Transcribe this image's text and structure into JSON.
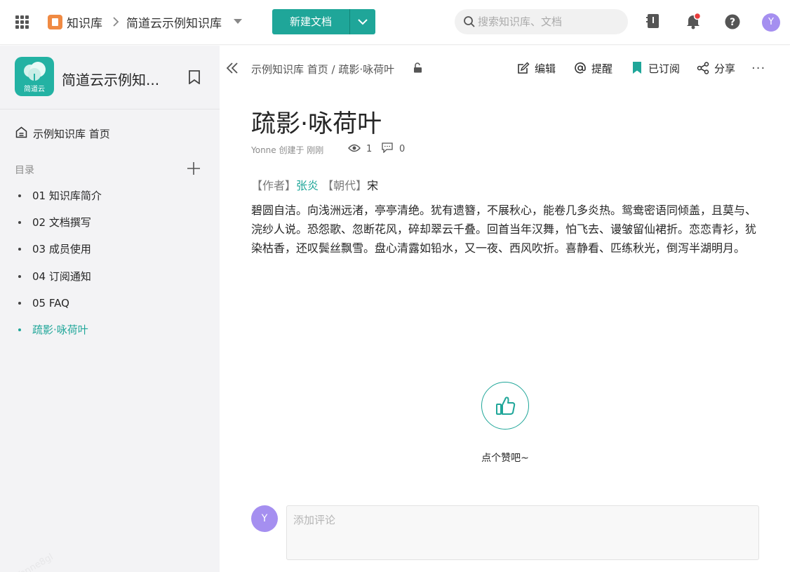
{
  "topbar": {
    "kb_label": "知识库",
    "space_name": "简道云示例知识库",
    "new_doc_label": "新建文档",
    "search_placeholder": "搜索知识库、文档",
    "avatar_initial": "Y",
    "notification_dot_color": "#e83c3c",
    "accent_color": "#1fa699"
  },
  "sidebar": {
    "logo_text": "简道云",
    "title": "简道云示例知...",
    "home_label": "示例知识库 首页",
    "toc_title": "目录",
    "items": [
      {
        "label": "01 知识库简介",
        "active": false
      },
      {
        "label": "02 文档撰写",
        "active": false
      },
      {
        "label": "03 成员使用",
        "active": false
      },
      {
        "label": "04 订阅通知",
        "active": false
      },
      {
        "label": "05 FAQ",
        "active": false
      },
      {
        "label": "疏影·咏荷叶",
        "active": true
      }
    ]
  },
  "main": {
    "breadcrumb": {
      "home": "示例知识库 首页",
      "sep": " / ",
      "current": "疏影·咏荷叶"
    },
    "actions": {
      "edit": "编辑",
      "remind": "提醒",
      "subscribed": "已订阅",
      "share": "分享"
    },
    "doc": {
      "title": "疏影·咏荷叶",
      "creator": "Yonne 创建于 刚刚",
      "views": "1",
      "comments": "0",
      "author_tag": "【作者】",
      "author_name": "张炎",
      "dynasty_tag": "【朝代】",
      "dynasty": "宋",
      "body": "碧圆自洁。向浅洲远渚，亭亭清绝。犹有遗簪，不展秋心，能卷几多炎热。鸳鸯密语同倾盖，且莫与、浣纱人说。恐怨歌、忽断花风，碎却翠云千叠。回首当年汉舞，怕飞去、谩皱留仙裙折。恋恋青衫，犹染枯香，还叹鬓丝飘雪。盘心清露如铅水，又一夜、西风吹折。喜静看、匹练秋光，倒泻半湖明月。"
    },
    "like_label": "点个赞吧~",
    "comment": {
      "avatar_initial": "Y",
      "placeholder": "添加评论"
    }
  }
}
